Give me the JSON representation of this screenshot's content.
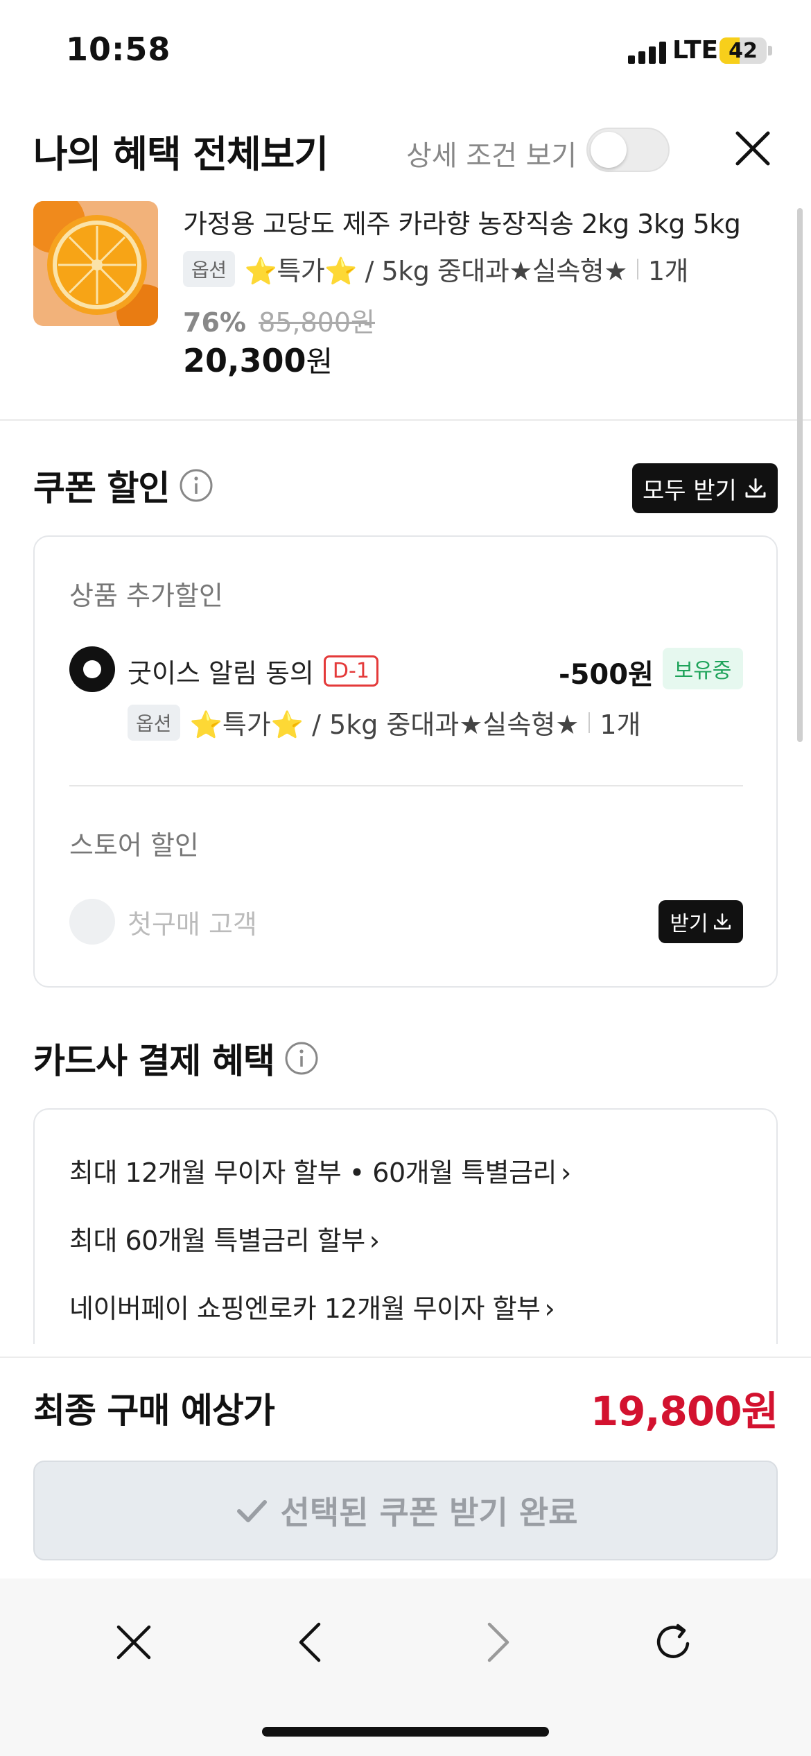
{
  "status_bar": {
    "time": "10:58",
    "network": "LTE",
    "battery": "42",
    "battery_level": 0.42
  },
  "header": {
    "title": "나의 혜택 전체보기",
    "detail_toggle_label": "상세 조건 보기"
  },
  "product": {
    "name": "가정용 고당도 제주 카라향 농장직송 2kg 3kg 5kg",
    "option_badge": "옵션",
    "option_text": "⭐특가⭐ / 5kg 중대과★실속형★",
    "quantity": "1개",
    "discount_rate": "76%",
    "original_price": "85,800원",
    "final_price_number": "20,300",
    "final_price_unit": "원"
  },
  "coupon_section": {
    "title": "쿠폰 할인",
    "receive_all_label": "모두 받기",
    "product_extra": {
      "heading": "상품 추가할인",
      "coupon_name": "굿이스 알림 동의",
      "dday": "D-1",
      "amount": "-500원",
      "status": "보유중",
      "option_badge": "옵션",
      "option_text": "⭐특가⭐ / 5kg 중대과★실속형★",
      "quantity": "1개"
    },
    "store": {
      "heading": "스토어 할인",
      "coupon_name": "첫구매 고객",
      "receive_label": "받기"
    }
  },
  "card_section": {
    "title": "카드사 결제 혜택",
    "items": [
      "최대 12개월 무이자 할부 • 60개월 특별금리",
      "최대 60개월 특별금리 할부",
      "네이버페이 쇼핑엔로카 12개월 무이자 할부"
    ]
  },
  "summary": {
    "label": "최종 구매 예상가",
    "price": "19,800원",
    "done_label": "선택된 쿠폰 받기 완료"
  },
  "colors": {
    "accent_red": "#d3122f",
    "owned_green": "#1ea35a",
    "dday_red": "#e43a3a"
  }
}
